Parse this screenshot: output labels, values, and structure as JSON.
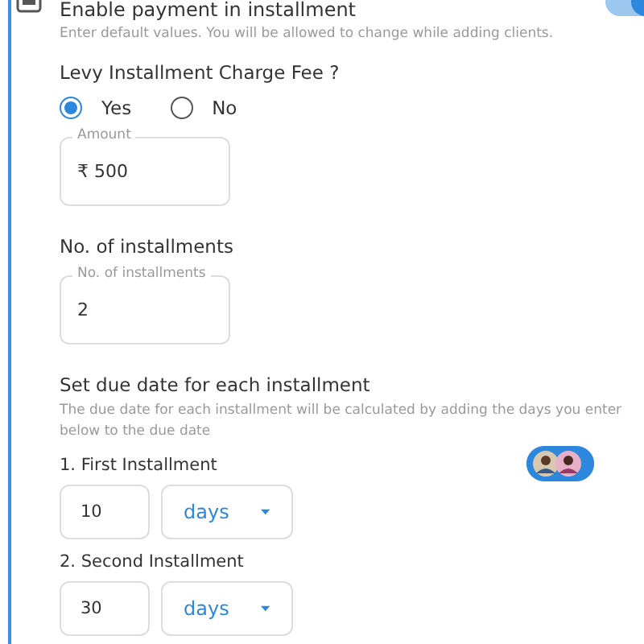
{
  "header": {
    "title": "Enable payment in installment",
    "subtitle": "Enter default values. You will be allowed to change while adding clients.",
    "toggle_on": true
  },
  "levy": {
    "label": "Levy Installment Charge Fee ?",
    "options": [
      {
        "label": "Yes",
        "selected": true
      },
      {
        "label": "No",
        "selected": false
      }
    ],
    "amount": {
      "label": "Amount",
      "value": "₹ 500"
    }
  },
  "installments": {
    "label": "No. of installments",
    "field": {
      "label": "No. of installments",
      "value": "2"
    }
  },
  "due_dates": {
    "title": "Set due date for each installment",
    "hint": "The due date for each installment will be calculated by adding the days you enter below to the due date",
    "items": [
      {
        "label": "1.  First Installment",
        "value": "10",
        "unit": "days"
      },
      {
        "label": "2.  Second Installment",
        "value": "30",
        "unit": "days"
      }
    ]
  }
}
